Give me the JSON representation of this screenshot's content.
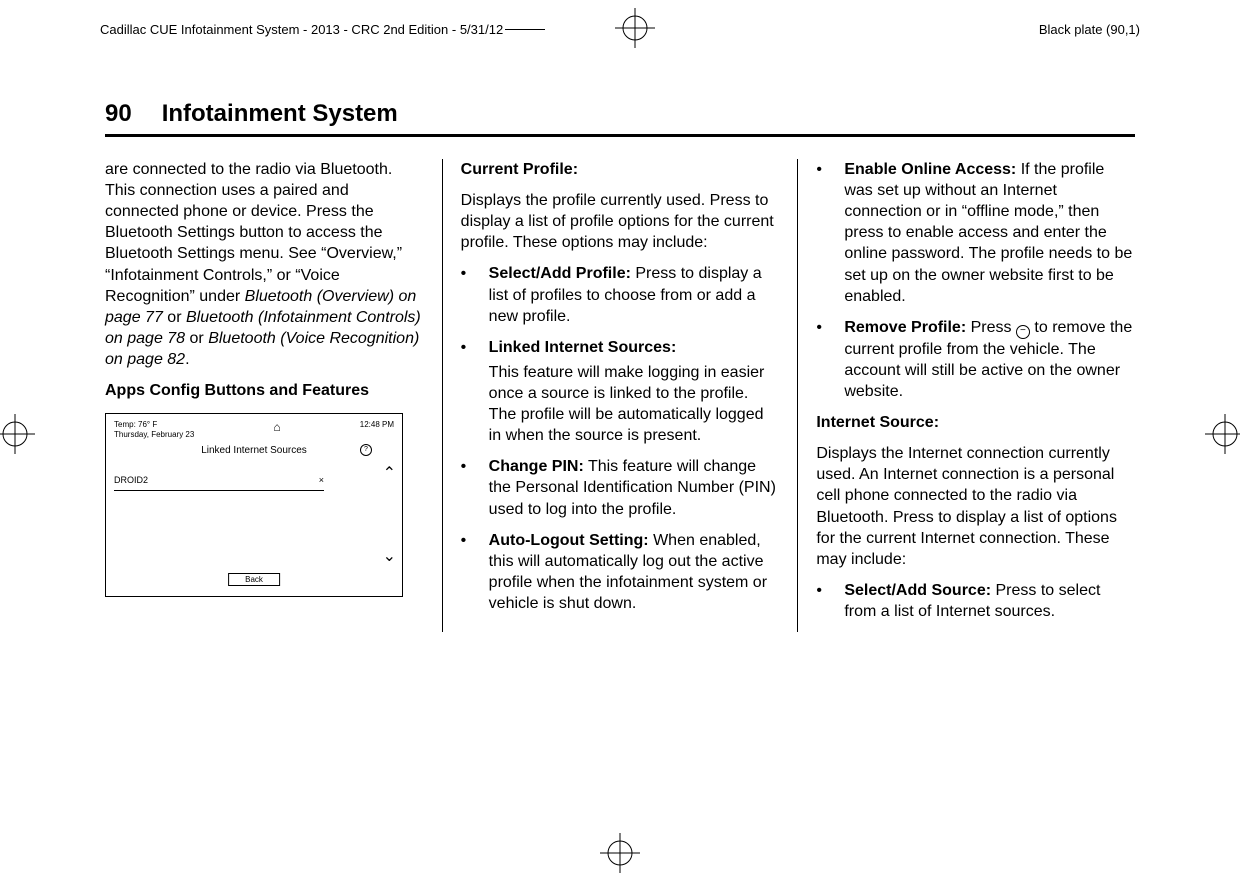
{
  "header": {
    "doc_info": "Cadillac CUE Infotainment System - 2013 - CRC 2nd Edition - 5/31/12",
    "plate": "Black plate (90,1)"
  },
  "page_number": "90",
  "section_title": "Infotainment System",
  "col1": {
    "para1_a": "are connected to the radio via Bluetooth. This connection uses a paired and connected phone or device. Press the Bluetooth Settings button to access the Bluetooth Settings menu. See “Overview,” “Infotainment Controls,” or “Voice Recognition” under ",
    "para1_b": "Bluetooth (Overview) on page 77",
    "para1_c": " or ",
    "para1_d": "Bluetooth (Infotainment Controls) on page 78",
    "para1_e": " or ",
    "para1_f": "Bluetooth (Voice Recognition) on page 82",
    "para1_g": ".",
    "heading": "Apps Config Buttons and Features",
    "mock": {
      "temp": "Temp: 76° F",
      "date": "Thursday, February 23",
      "home_icon": "⌂",
      "time": "12:48 PM",
      "title": "Linked Internet Sources",
      "q": "?",
      "row_label": "DROID2",
      "row_x": "×",
      "up": "⌃",
      "down": "⌄",
      "back": "Back"
    }
  },
  "col2": {
    "h1": "Current Profile:",
    "p1": "Displays the profile currently used. Press to display a list of profile options for the current profile. These options may include:",
    "b1_t": "Select/Add Profile:",
    "b1_d": " Press to display a list of profiles to choose from or add a new profile.",
    "b2_t": "Linked Internet Sources:",
    "b2_d": "This feature will make logging in easier once a source is linked to the profile. The profile will be automatically logged in when the source is present.",
    "b3_t": "Change PIN:",
    "b3_d": " This feature will change the Personal Identification Number (PIN) used to log into the profile.",
    "b4_t": "Auto-Logout Setting:",
    "b4_d": " When enabled, this will automatically log out the active profile when the infotainment system or vehicle is shut down."
  },
  "col3": {
    "b5_t": "Enable Online Access:",
    "b5_d": " If the profile was set up without an Internet connection or in “offline mode,” then press to enable access and enter the online password. The profile needs to be set up on the owner website first to be enabled.",
    "b6_t": "Remove Profile:",
    "b6_a": " Press ",
    "b6_icon": "−",
    "b6_b": " to remove the current profile from the vehicle. The account will still be active on the owner website.",
    "h2": "Internet Source:",
    "p2": "Displays the Internet connection currently used. An Internet connection is a personal cell phone connected to the radio via Bluetooth. Press to display a list of options for the current Internet connection. These may include:",
    "b7_t": "Select/Add Source:",
    "b7_d": " Press to select from a list of Internet sources."
  }
}
